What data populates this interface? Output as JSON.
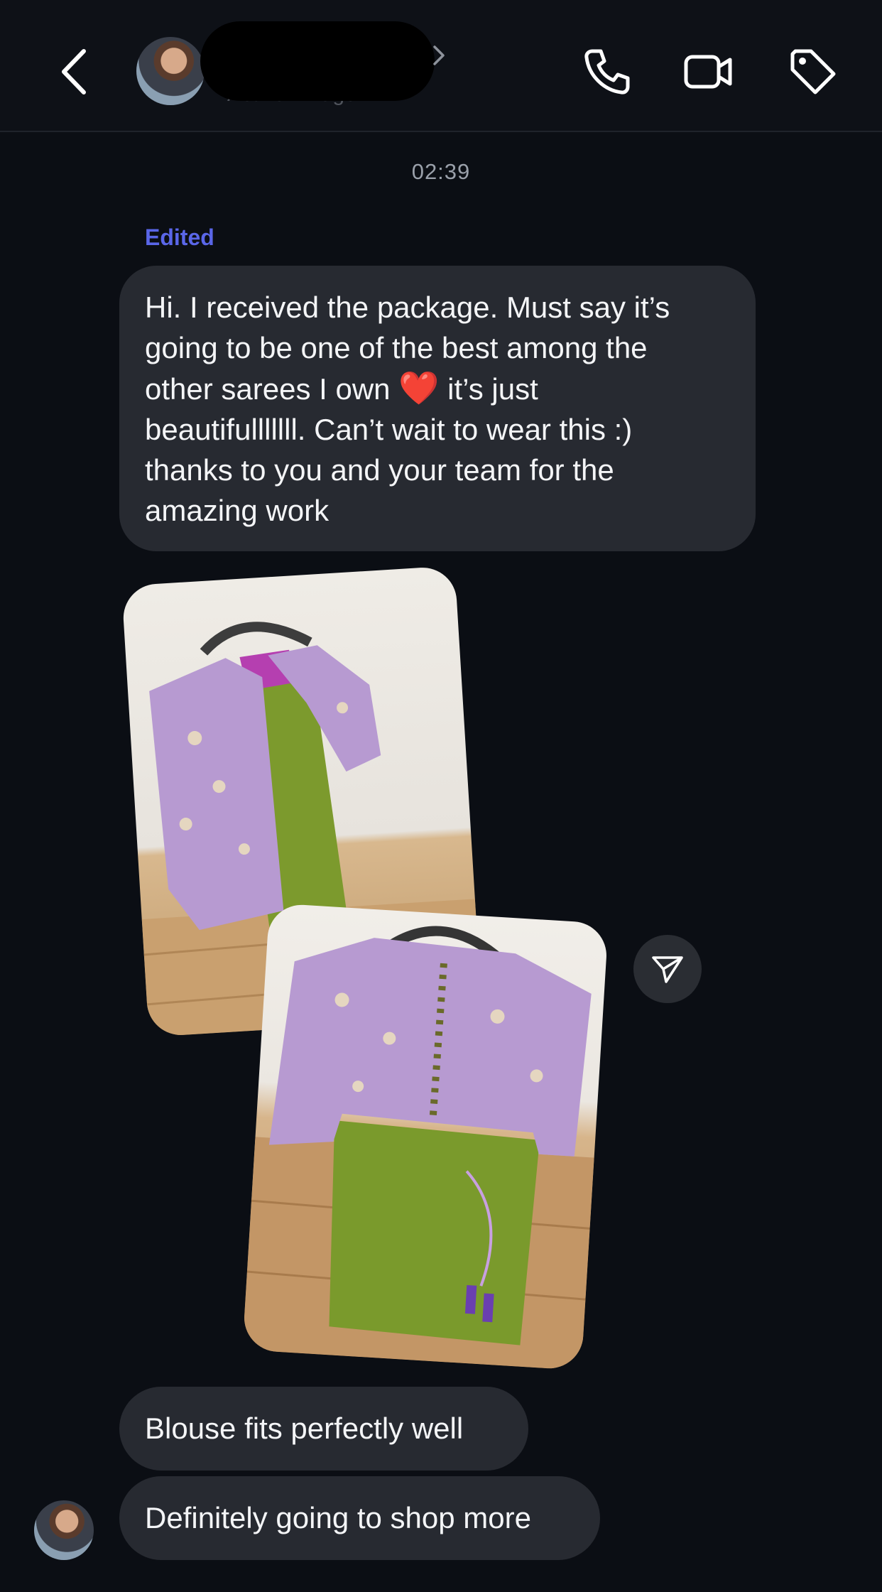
{
  "header": {
    "subtitle_partial": "Active 4h ago",
    "icons": [
      "back-icon",
      "chevron-right-icon",
      "phone-icon",
      "video-icon",
      "tag-icon"
    ]
  },
  "conversation": {
    "timestamp": "02:39",
    "edited_label": "Edited",
    "message_1_before_heart": "Hi. I received the package. Must say it’s\ngoing to be one of the best among the\nother sarees I own ",
    "message_1_heart": "❤️",
    "message_1_after_heart": " it’s just\nbeautifulllllll. Can’t wait to wear this :)\nthanks to you and your team for the\namazing work",
    "message_2": "Blouse fits perfectly well",
    "message_3": "Definitely going to shop more"
  },
  "colors": {
    "background": "#0b0e14",
    "bubble": "#272a31",
    "edited_accent": "#5a66e8"
  }
}
